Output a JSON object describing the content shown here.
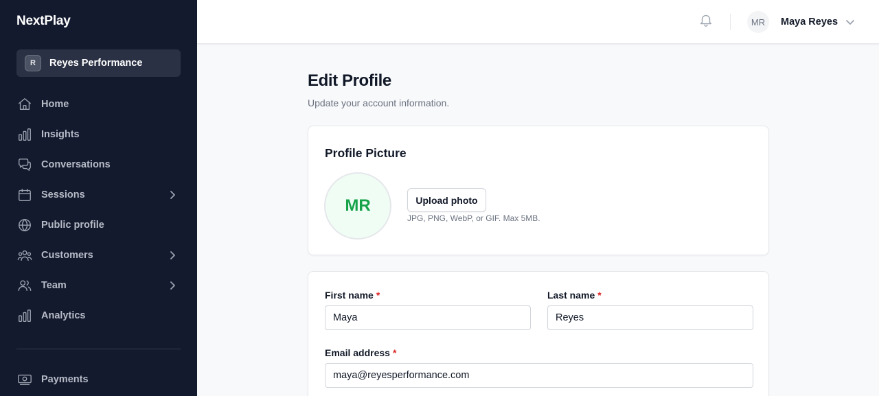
{
  "sidebar": {
    "brand": "NextPlay",
    "workspace": {
      "initial": "R",
      "name": "Reyes Performance"
    },
    "items": [
      {
        "label": "Home",
        "icon": "home-icon"
      },
      {
        "label": "Insights",
        "icon": "bar-chart-icon"
      },
      {
        "label": "Conversations",
        "icon": "chat-bubbles-icon"
      },
      {
        "label": "Sessions",
        "icon": "calendar-icon",
        "expandable": true
      },
      {
        "label": "Public profile",
        "icon": "globe-icon"
      },
      {
        "label": "Customers",
        "icon": "users-group-icon",
        "expandable": true
      },
      {
        "label": "Team",
        "icon": "users-icon",
        "expandable": true
      },
      {
        "label": "Analytics",
        "icon": "bar-chart-icon"
      },
      {
        "label": "Payments",
        "icon": "cash-icon"
      }
    ]
  },
  "topbar": {
    "user_initials": "MR",
    "user_name": "Maya Reyes"
  },
  "page": {
    "title": "Edit Profile",
    "subtitle": "Update your account information."
  },
  "profile_picture": {
    "title": "Profile Picture",
    "initials": "MR",
    "upload_label": "Upload photo",
    "hint": "JPG, PNG, WebP, or GIF. Max 5MB."
  },
  "form": {
    "required_marker": "*",
    "first_name": {
      "label": "First name",
      "value": "Maya"
    },
    "last_name": {
      "label": "Last name",
      "value": "Reyes"
    },
    "email": {
      "label": "Email address",
      "value": "maya@reyesperformance.com"
    }
  },
  "colors": {
    "sidebar_bg": "#141a2e",
    "accent_green": "#16a34a",
    "required_red": "#dc2626"
  }
}
